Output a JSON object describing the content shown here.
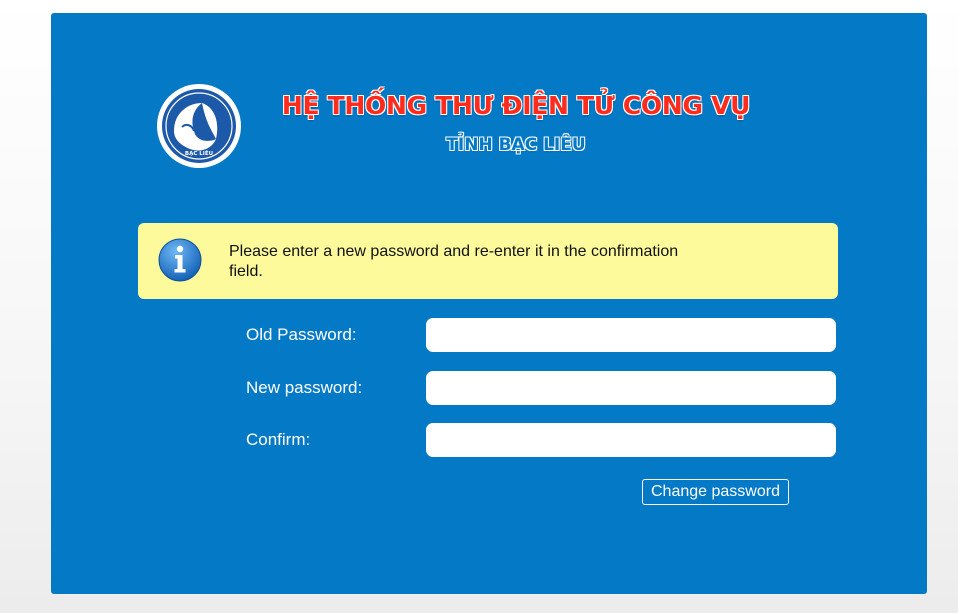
{
  "header": {
    "title": "HỆ THỐNG THƯ ĐIỆN TỬ CÔNG VỤ",
    "subtitle": "TỈNH BẠC LIÊU",
    "logo_text": "BẠC LIÊU",
    "logo_icon": "bac-lieu-emblem"
  },
  "notice": {
    "icon": "info-icon",
    "text": "Please enter a new password and re-enter it in the confirmation field."
  },
  "form": {
    "old_password_label": "Old Password:",
    "old_password_value": "",
    "new_password_label": "New password:",
    "new_password_value": "",
    "confirm_label": "Confirm:",
    "confirm_value": "",
    "submit_label": "Change password"
  },
  "colors": {
    "panel_background": "#0479c6",
    "title_red": "#ff2b1c",
    "notice_background": "#fdfa9b",
    "info_blue": "#1f7fd4"
  }
}
